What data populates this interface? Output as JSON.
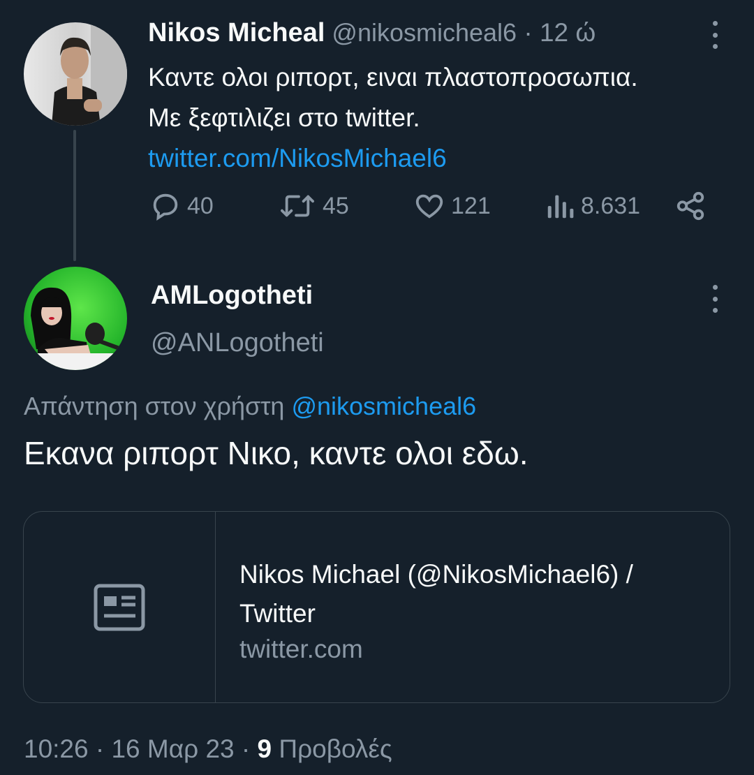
{
  "tweet1": {
    "name": "Nikos Micheal",
    "handle": "@nikosmicheal6",
    "sep": "·",
    "time": "12 ώ",
    "line1": "Καντε ολοι ριπορτ, ειναι πλαστοπροσωπια.",
    "line2": "Με ξεφτιλιζει στο twitter.",
    "link": "twitter.com/NikosMichael6",
    "replies": "40",
    "retweets": "45",
    "likes": "121",
    "views": "8.631"
  },
  "tweet2": {
    "name": "AMLogotheti",
    "handle": "@ANLogotheti",
    "reply_label": "Απάντηση στον χρήστη",
    "reply_handle": "@nikosmicheal6",
    "body": "Εκανα ριπορτ Νικο, καντε ολοι εδω.",
    "card": {
      "title": "Nikos Michael (@NikosMichael6) / Twitter",
      "domain": "twitter.com"
    },
    "time": "10:26",
    "sep": "·",
    "date": "16 Μαρ 23",
    "views_count": "9",
    "views_label": "Προβολές"
  },
  "icons": {
    "reply": "reply-icon",
    "retweet": "retweet-icon",
    "like": "heart-icon",
    "views": "views-icon",
    "share": "share-icon",
    "card": "article-icon",
    "more": "more-icon"
  },
  "colors": {
    "background": "#15202b",
    "text": "#f7f9f9",
    "muted": "#8b98a5",
    "link": "#1d9bf0",
    "border": "#38444d"
  }
}
